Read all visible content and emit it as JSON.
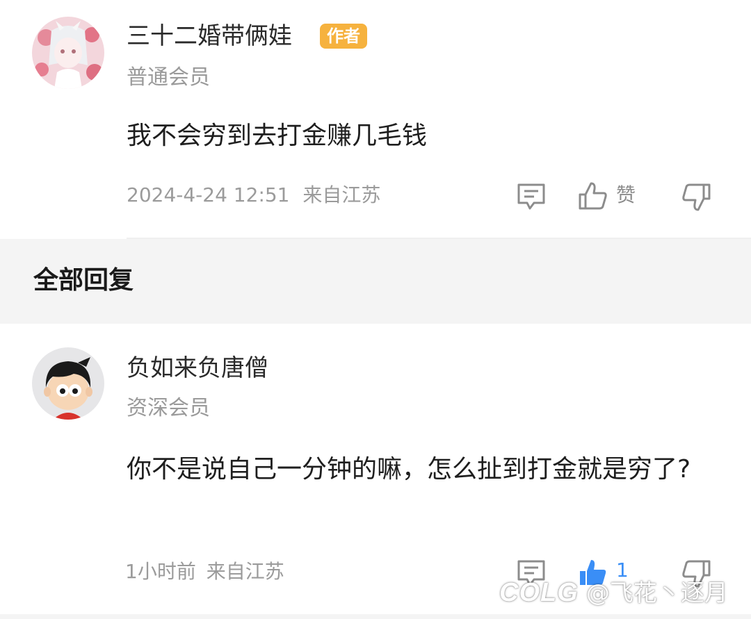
{
  "post": {
    "author_name": "三十二婚带俩娃",
    "author_badge": "作者",
    "member_level": "普通会员",
    "content": "我不会穷到去打金赚几毛钱",
    "timestamp": "2024-4-24 12:51",
    "location": "来自江苏",
    "like_label": "赞"
  },
  "section": {
    "title": "全部回复"
  },
  "reply": {
    "author_name": "负如来负唐僧",
    "member_level": "资深会员",
    "content": "你不是说自己一分钟的嘛，怎么扯到打金就是穷了?",
    "time_ago": "1小时前",
    "location": "来自江苏",
    "like_count": "1"
  },
  "watermark": {
    "logo_text": "COLG",
    "handle": "@飞花丶逐月"
  },
  "colors": {
    "badge": "#f6b23e",
    "like_active": "#3a8ef6",
    "section_bg": "#f4f4f4"
  }
}
